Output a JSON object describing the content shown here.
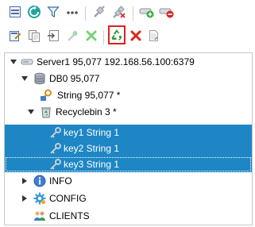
{
  "toolbar_row1": [
    {
      "icon": "collapse-icon"
    },
    {
      "icon": "refresh-icon"
    },
    {
      "icon": "filter-icon"
    },
    {
      "icon": "more-icon"
    },
    {
      "icon": "connect-icon"
    },
    {
      "icon": "disconnect-icon"
    },
    {
      "icon": "add-server-icon"
    },
    {
      "icon": "remove-server-icon"
    }
  ],
  "toolbar_row2": [
    {
      "icon": "edit-icon"
    },
    {
      "icon": "copy-icon"
    },
    {
      "icon": "rename-icon"
    },
    {
      "icon": "add-key-icon"
    },
    {
      "icon": "delete-icon"
    },
    {
      "icon": "recycle-icon",
      "active": true
    },
    {
      "icon": "clear-icon"
    },
    {
      "icon": "document-icon"
    }
  ],
  "tree": {
    "server": {
      "label": "Server1 95,077 192.168.56.100:6379"
    },
    "db": {
      "label": "DB0 95,077"
    },
    "string_group": {
      "label": "String 95,077 *"
    },
    "recyclebin": {
      "label": "Recyclebin 3 *"
    },
    "keys": [
      {
        "label": "key1 String 1",
        "selected": true
      },
      {
        "label": "key2 String 1",
        "selected": true
      },
      {
        "label": "key3 String 1",
        "selected": true,
        "focused": true
      }
    ],
    "info": {
      "label": "INFO"
    },
    "config": {
      "label": "CONFIG"
    },
    "clients": {
      "label": "CLIENTS"
    }
  },
  "colors": {
    "selection": "#1e86c4",
    "active_border": "#e02020",
    "green": "#3aa93a",
    "red": "#d9261c"
  }
}
